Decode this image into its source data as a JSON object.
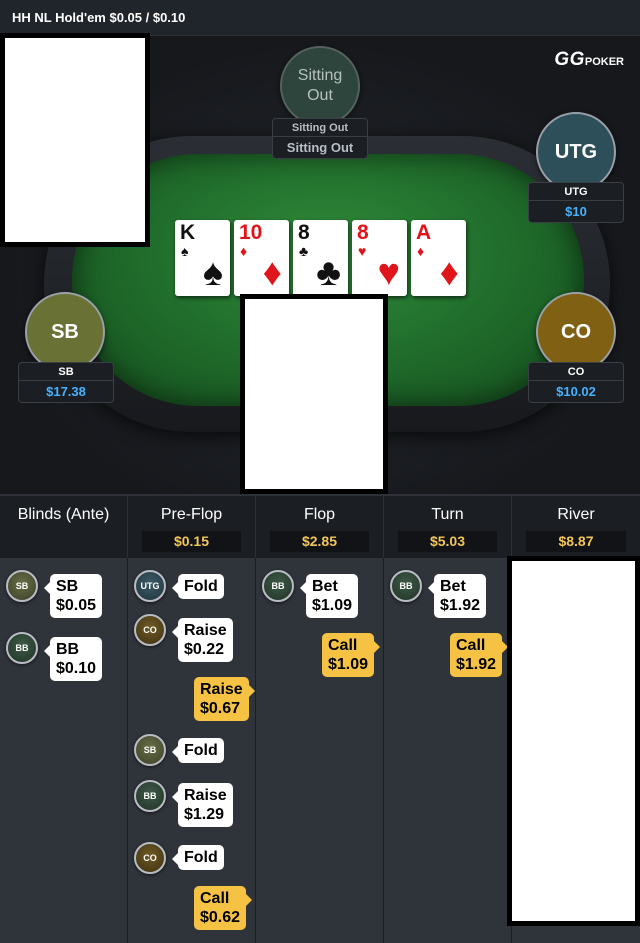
{
  "window": {
    "title": "HH NL Hold'em $0.05 / $0.10"
  },
  "brand": {
    "gg": "GG",
    "poker": "POKER"
  },
  "seats": {
    "sitting_out": {
      "label": "Sitting Out",
      "plate_name": "Sitting Out",
      "plate_status": "Sitting Out"
    },
    "utg": {
      "label": "UTG",
      "name": "UTG",
      "stack": "$10"
    },
    "sb": {
      "label": "SB",
      "name": "SB",
      "stack": "$17.38"
    },
    "co": {
      "label": "CO",
      "name": "CO",
      "stack": "$10.02"
    }
  },
  "board": [
    {
      "rank": "K",
      "suit": "♠",
      "color": "black"
    },
    {
      "rank": "10",
      "suit": "♦",
      "color": "red"
    },
    {
      "rank": "8",
      "suit": "♣",
      "color": "black"
    },
    {
      "rank": "8",
      "suit": "♥",
      "color": "red"
    },
    {
      "rank": "A",
      "suit": "♦",
      "color": "red"
    }
  ],
  "streets": [
    {
      "label": "Blinds (Ante)",
      "pot": ""
    },
    {
      "label": "Pre-Flop",
      "pot": "$0.15"
    },
    {
      "label": "Flop",
      "pot": "$2.85"
    },
    {
      "label": "Turn",
      "pot": "$5.03"
    },
    {
      "label": "River",
      "pot": "$8.87"
    }
  ],
  "actions": {
    "blinds": [
      {
        "pos": "SB",
        "text": "SB\n$0.05"
      },
      {
        "pos": "BB",
        "text": "BB\n$0.10"
      }
    ],
    "preflop": [
      {
        "pos": "UTG",
        "text": "Fold"
      },
      {
        "pos": "CO",
        "text": "Raise\n$0.22"
      },
      {
        "hero": true,
        "text": "Raise\n$0.67"
      },
      {
        "pos": "SB",
        "text": "Fold"
      },
      {
        "pos": "BB",
        "text": "Raise\n$1.29"
      },
      {
        "pos": "CO",
        "text": "Fold"
      },
      {
        "hero": true,
        "text": "Call\n$0.62"
      }
    ],
    "flop": [
      {
        "pos": "BB",
        "text": "Bet\n$1.09"
      },
      {
        "hero": true,
        "text": "Call\n$1.09"
      }
    ],
    "turn": [
      {
        "pos": "BB",
        "text": "Bet\n$1.92"
      },
      {
        "hero": true,
        "text": "Call\n$1.92"
      }
    ]
  },
  "colors": {
    "accent_pot": "#f3c65a",
    "stack_blue": "#46b3ff",
    "hero_bubble": "#f6c244",
    "felt": "#1f6a2a"
  }
}
